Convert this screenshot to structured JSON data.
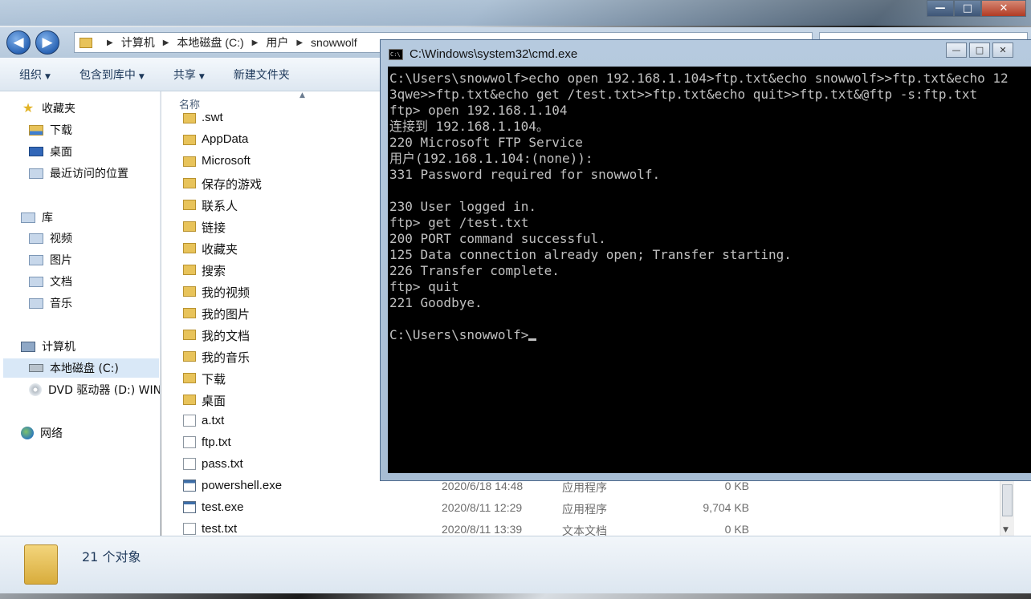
{
  "explorer": {
    "address_path": [
      "计算机",
      "本地磁盘 (C:)",
      "用户",
      "snowwolf"
    ],
    "toolbar": {
      "organize": "组织",
      "include_library": "包含到库中",
      "share": "共享",
      "new_folder": "新建文件夹"
    },
    "nav": {
      "favorites": "收藏夹",
      "downloads": "下载",
      "desktop": "桌面",
      "recent": "最近访问的位置",
      "libraries": "库",
      "videos": "视频",
      "pictures": "图片",
      "documents": "文档",
      "music": "音乐",
      "computer": "计算机",
      "local_disk": "本地磁盘 (C:)",
      "dvd": "DVD 驱动器 (D:) WIN",
      "network": "网络"
    },
    "column_name": "名称",
    "files": [
      {
        "name": ".swt",
        "icon": "folder",
        "date": "",
        "type": "",
        "size": ""
      },
      {
        "name": "AppData",
        "icon": "folder",
        "date": "",
        "type": "",
        "size": ""
      },
      {
        "name": "Microsoft",
        "icon": "folder",
        "date": "",
        "type": "",
        "size": ""
      },
      {
        "name": "保存的游戏",
        "icon": "folder",
        "date": "",
        "type": "",
        "size": ""
      },
      {
        "name": "联系人",
        "icon": "folder",
        "date": "",
        "type": "",
        "size": ""
      },
      {
        "name": "链接",
        "icon": "folder",
        "date": "",
        "type": "",
        "size": ""
      },
      {
        "name": "收藏夹",
        "icon": "folder",
        "date": "",
        "type": "",
        "size": ""
      },
      {
        "name": "搜索",
        "icon": "folder",
        "date": "",
        "type": "",
        "size": ""
      },
      {
        "name": "我的视频",
        "icon": "folder",
        "date": "",
        "type": "",
        "size": ""
      },
      {
        "name": "我的图片",
        "icon": "folder",
        "date": "",
        "type": "",
        "size": ""
      },
      {
        "name": "我的文档",
        "icon": "folder",
        "date": "",
        "type": "",
        "size": ""
      },
      {
        "name": "我的音乐",
        "icon": "folder",
        "date": "",
        "type": "",
        "size": ""
      },
      {
        "name": "下载",
        "icon": "folder",
        "date": "",
        "type": "",
        "size": ""
      },
      {
        "name": "桌面",
        "icon": "folder",
        "date": "",
        "type": "",
        "size": ""
      },
      {
        "name": "a.txt",
        "icon": "txt",
        "date": "",
        "type": "",
        "size": ""
      },
      {
        "name": "ftp.txt",
        "icon": "txt",
        "date": "",
        "type": "",
        "size": ""
      },
      {
        "name": "pass.txt",
        "icon": "txt",
        "date": "",
        "type": "",
        "size": ""
      },
      {
        "name": "powershell.exe",
        "icon": "exe",
        "date": "2020/6/18 14:48",
        "type": "应用程序",
        "size": "0 KB"
      },
      {
        "name": "test.exe",
        "icon": "exe",
        "date": "2020/8/11 12:29",
        "type": "应用程序",
        "size": "9,704 KB"
      },
      {
        "name": "test.txt",
        "icon": "txt",
        "date": "2020/8/11 13:39",
        "type": "文本文档",
        "size": "0 KB"
      }
    ],
    "status_count": "21 个对象"
  },
  "cmd": {
    "title": "C:\\Windows\\system32\\cmd.exe",
    "icon_text": "C:\\",
    "lines": [
      "C:\\Users\\snowwolf>echo open 192.168.1.104>ftp.txt&echo snowwolf>>ftp.txt&echo 12",
      "3qwe>>ftp.txt&echo get /test.txt>>ftp.txt&echo quit>>ftp.txt&@ftp -s:ftp.txt",
      "ftp> open 192.168.1.104",
      "连接到 192.168.1.104。",
      "220 Microsoft FTP Service",
      "用户(192.168.1.104:(none)):",
      "331 Password required for snowwolf.",
      "",
      "230 User logged in.",
      "ftp> get /test.txt",
      "200 PORT command successful.",
      "125 Data connection already open; Transfer starting.",
      "226 Transfer complete.",
      "ftp> quit",
      "221 Goodbye.",
      "",
      "C:\\Users\\snowwolf>"
    ]
  }
}
